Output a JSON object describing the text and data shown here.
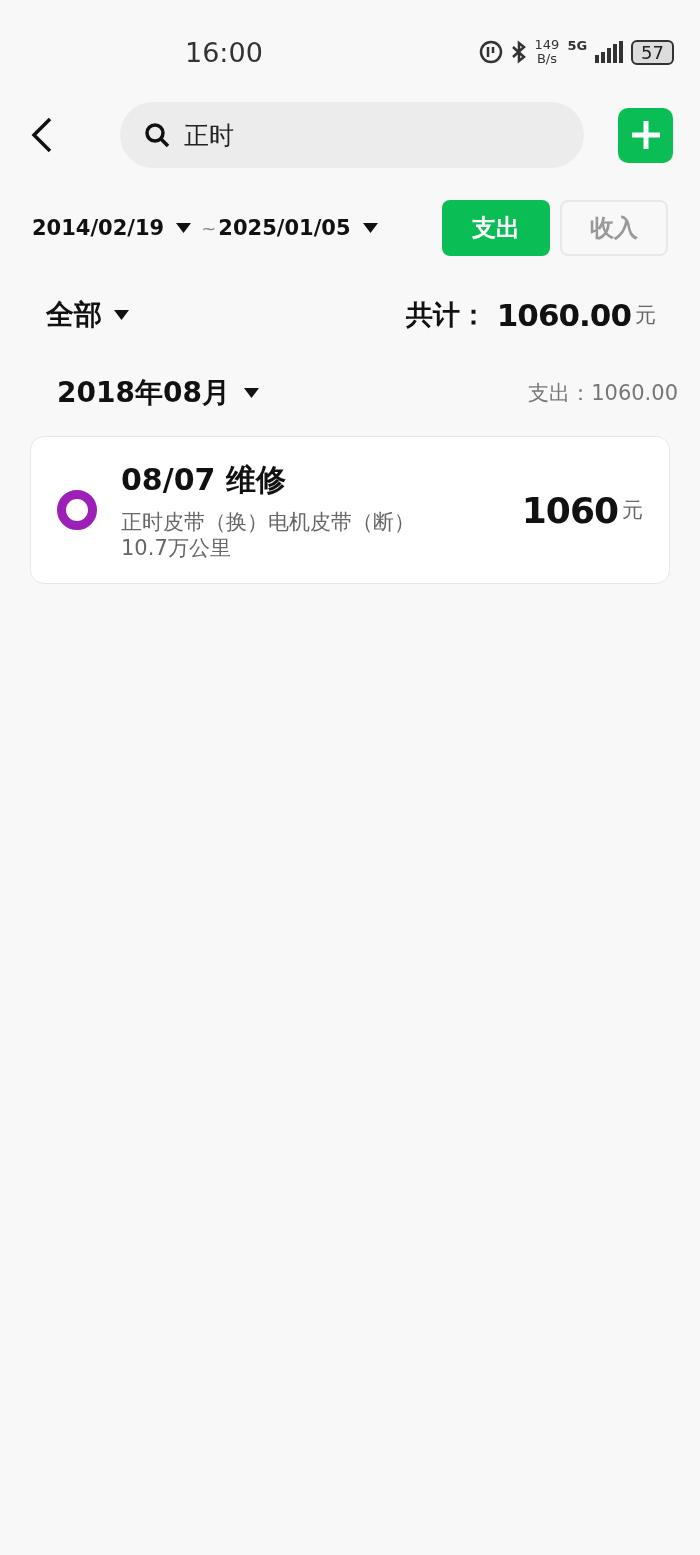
{
  "status_bar": {
    "time": "16:00",
    "speed_value": "149",
    "speed_unit": "B/s",
    "network": "5G",
    "battery": "57"
  },
  "search": {
    "value": "正时"
  },
  "date_range": {
    "start": "2014/02/19",
    "separator": "~",
    "end": "2025/01/05"
  },
  "type_tabs": [
    {
      "label": "支出",
      "selected": true
    },
    {
      "label": "收入",
      "selected": false
    }
  ],
  "filter": {
    "label": "全部"
  },
  "total": {
    "label": "共计：",
    "amount": "1060.00",
    "unit": "元"
  },
  "groups": [
    {
      "month": "2018年08月",
      "summary": "支出：1060.00",
      "entries": [
        {
          "date": "08/07",
          "category": "维修",
          "note": "正时皮带（换）电机皮带（断）",
          "mileage": "10.7万公里",
          "amount": "1060",
          "unit": "元",
          "color": "#9c1fb8"
        }
      ]
    }
  ]
}
